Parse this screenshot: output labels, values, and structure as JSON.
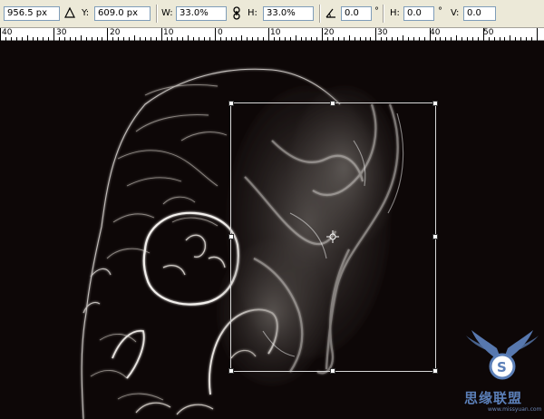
{
  "options_bar": {
    "x_value": "956.5 px",
    "y_label": "Y:",
    "y_value": "609.0 px",
    "w_label": "W:",
    "w_value": "33.0%",
    "h_label": "H:",
    "h_value": "33.0%",
    "angle_value": "0.0",
    "angle_unit": "°",
    "skew_h_label": "H:",
    "skew_h_value": "0.0",
    "skew_h_unit": "°",
    "skew_v_label": "V:",
    "skew_v_value": "0.0",
    "icons": {
      "reference_point": "delta-triangle-icon",
      "link": "link-chain-icon",
      "rotate": "angle-icon"
    }
  },
  "ruler": {
    "labels": [
      "40",
      "30",
      "20",
      "10",
      "0",
      "10",
      "20",
      "30",
      "40",
      "50"
    ]
  },
  "watermark": {
    "text": "思缘联盟",
    "url": "www.missyuan.com"
  },
  "colors": {
    "background": "#0d0707",
    "toolbar": "#ece9d8",
    "watermark": "#5b7fb8"
  }
}
